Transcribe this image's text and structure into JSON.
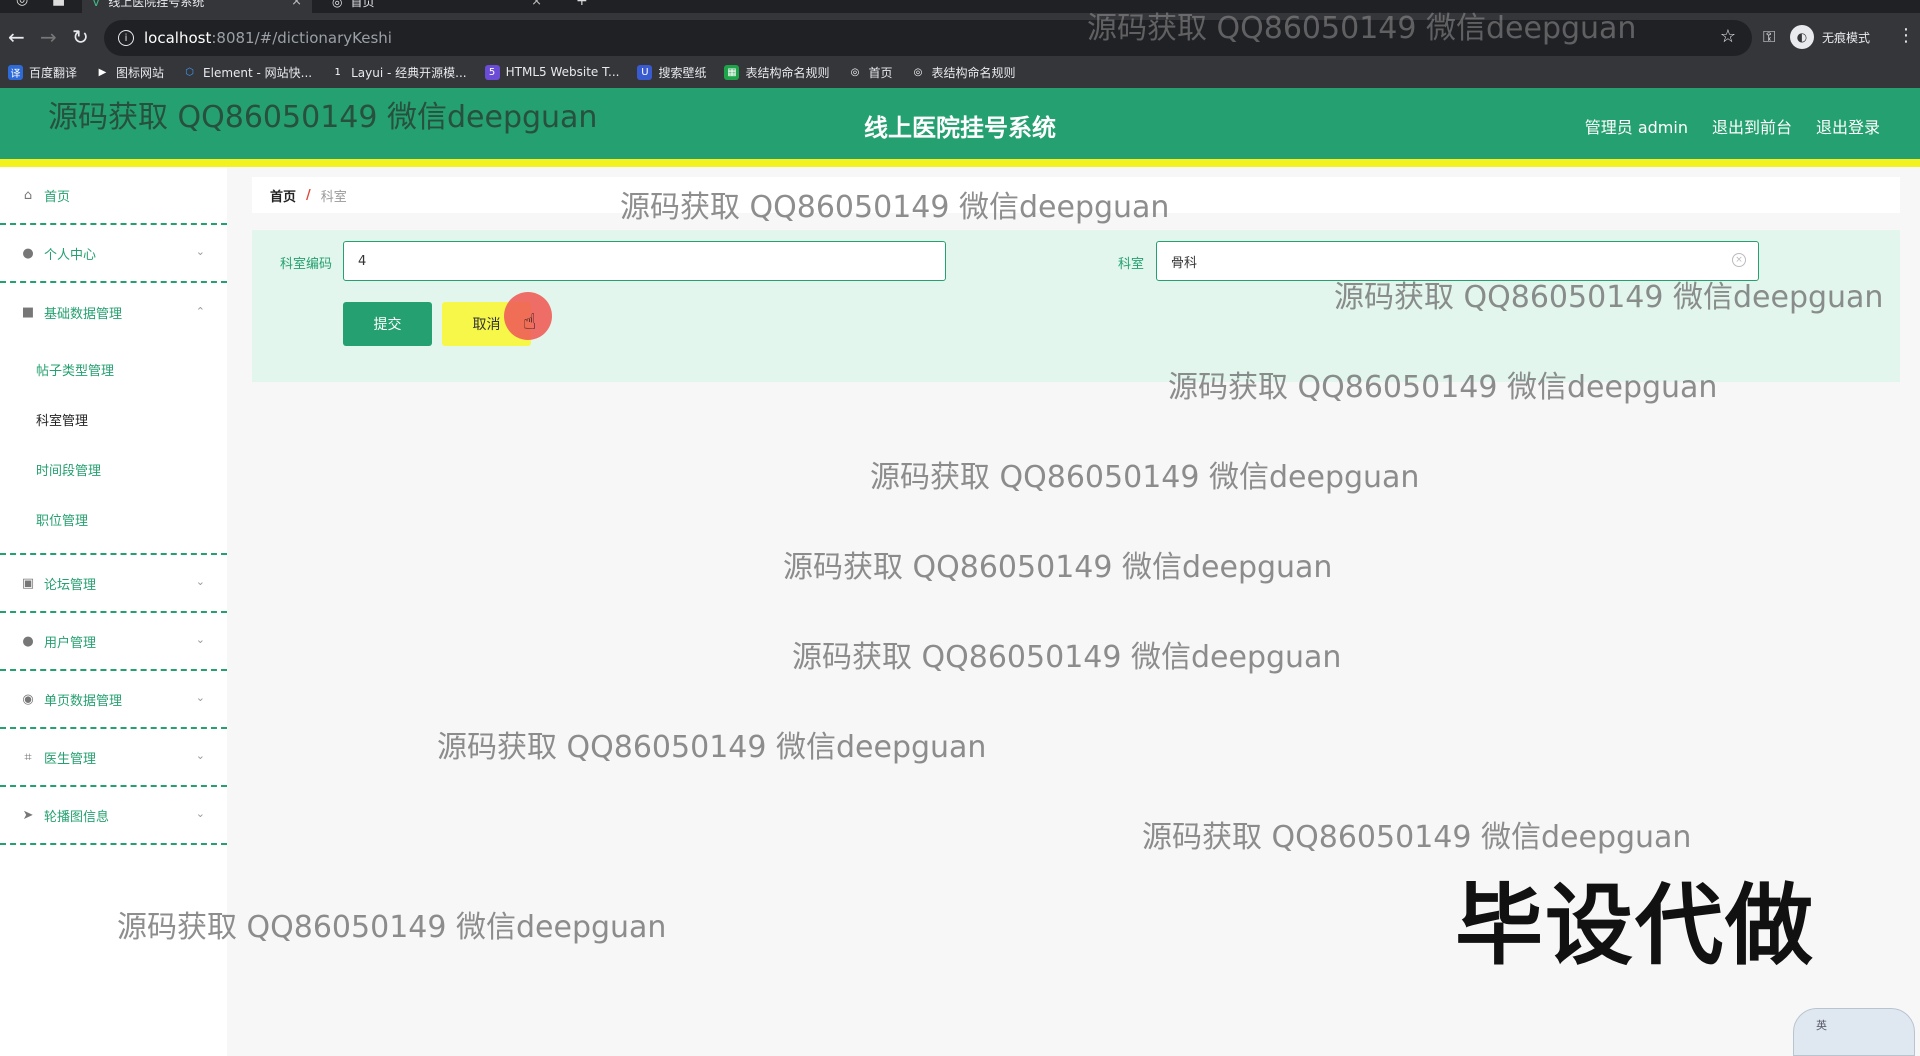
{
  "browser": {
    "tabs": [
      {
        "title": "线上医院挂号系统",
        "active": true
      },
      {
        "title": "首页",
        "active": false
      }
    ],
    "new_tab": "+",
    "url_host": "localhost",
    "url_path": ":8081/#/dictionaryKeshi",
    "incognito_label": "无痕模式",
    "bookmarks": [
      {
        "label": "百度翻译",
        "color": "#2e6bd8",
        "icon": "译"
      },
      {
        "label": "图标网站",
        "color": "#333333",
        "icon": "▶"
      },
      {
        "label": "Element - 网站快...",
        "color": "#409eff",
        "icon": "⬡"
      },
      {
        "label": "Layui - 经典开源模...",
        "color": "#333333",
        "icon": "1"
      },
      {
        "label": "HTML5 Website T...",
        "color": "#6a4cd6",
        "icon": "5"
      },
      {
        "label": "搜索壁纸",
        "color": "#3a5bd0",
        "icon": "U"
      },
      {
        "label": "表结构命名规则",
        "color": "#1fa34a",
        "icon": "▦"
      },
      {
        "label": "首页",
        "color": "#333333",
        "icon": "◎"
      },
      {
        "label": "表结构命名规则",
        "color": "#333333",
        "icon": "◎"
      }
    ]
  },
  "header": {
    "title": "线上医院挂号系统",
    "admin_label": "管理员 admin",
    "front_label": "退出到前台",
    "logout_label": "退出登录",
    "color": "#25a070"
  },
  "sidebar": {
    "items": [
      {
        "label": "首页",
        "icon": "home-icon",
        "glyph": "⌂"
      },
      {
        "label": "个人中心",
        "icon": "user-icon",
        "glyph": "●"
      },
      {
        "label": "基础数据管理",
        "icon": "video-icon",
        "glyph": "■"
      },
      {
        "label": "论坛管理",
        "icon": "clipboard-icon",
        "glyph": "▣"
      },
      {
        "label": "用户管理",
        "icon": "user-icon",
        "glyph": "●"
      },
      {
        "label": "单页数据管理",
        "icon": "location-icon",
        "glyph": "◉"
      },
      {
        "label": "医生管理",
        "icon": "crop-icon",
        "glyph": "⌗"
      },
      {
        "label": "轮播图信息",
        "icon": "send-icon",
        "glyph": "➤"
      }
    ],
    "sub_items": [
      {
        "label": "帖子类型管理"
      },
      {
        "label": "科室管理"
      },
      {
        "label": "时间段管理"
      },
      {
        "label": "职位管理"
      }
    ]
  },
  "breadcrumb": {
    "home": "首页",
    "separator": "/",
    "current": "科室"
  },
  "form": {
    "code_label": "科室编码",
    "code_value": "4",
    "name_label": "科室",
    "name_value": "骨科",
    "submit_label": "提交",
    "cancel_label": "取消"
  },
  "watermarks": {
    "text": "源码获取 QQ86050149 微信deepguan",
    "big": "毕设代做",
    "ime": "英"
  }
}
